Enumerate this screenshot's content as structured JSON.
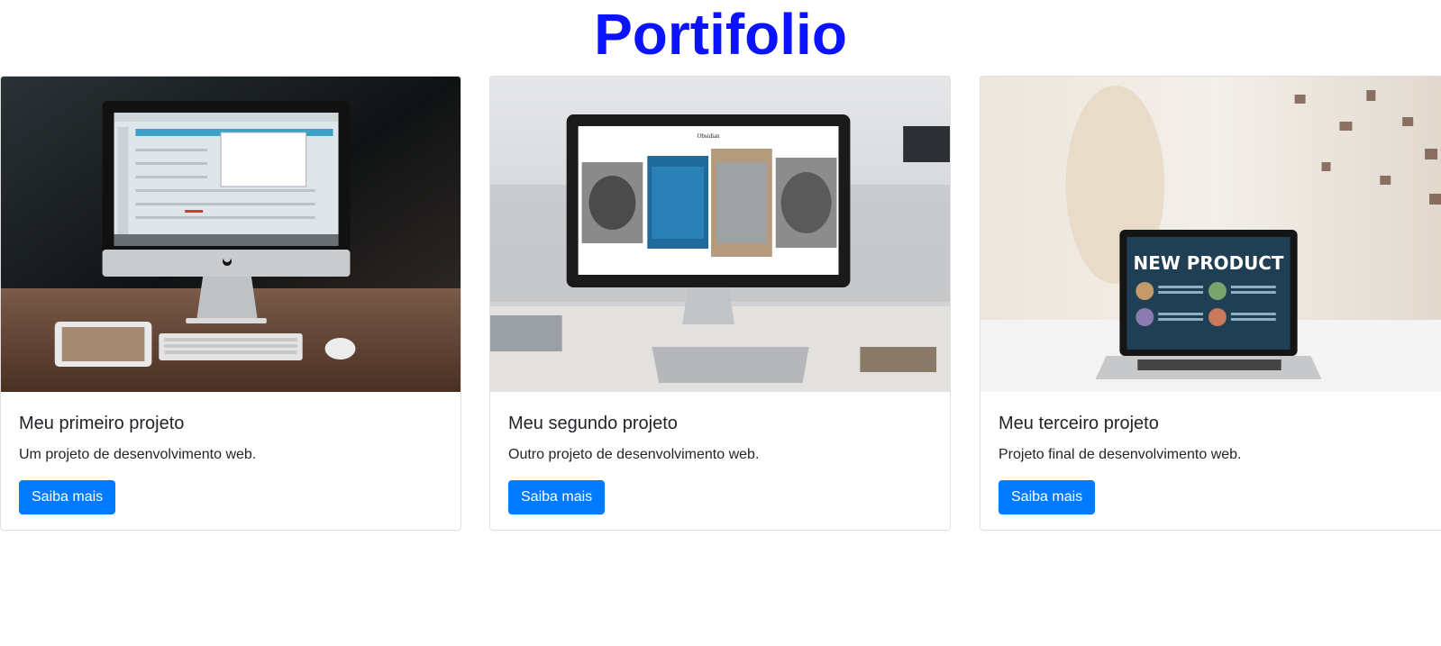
{
  "page": {
    "title": "Portifolio",
    "title_color": "#0a12ff"
  },
  "projects": [
    {
      "title": "Meu primeiro projeto",
      "text": "Um projeto de desenvolvimento web.",
      "button_label": "Saiba mais",
      "image": "imac-desk-photo"
    },
    {
      "title": "Meu segundo projeto",
      "text": "Outro projeto de desenvolvimento web.",
      "button_label": "Saiba mais",
      "image": "imac-portfolio-site-photo",
      "image_site_name": "Obsidian"
    },
    {
      "title": "Meu terceiro projeto",
      "text": "Projeto final de desenvolvimento web.",
      "button_label": "Saiba mais",
      "image": "laptop-new-product-photo",
      "image_headline": "NEW PRODUCT"
    }
  ],
  "colors": {
    "button": "#007bff",
    "card_border": "#dfdfdf"
  }
}
